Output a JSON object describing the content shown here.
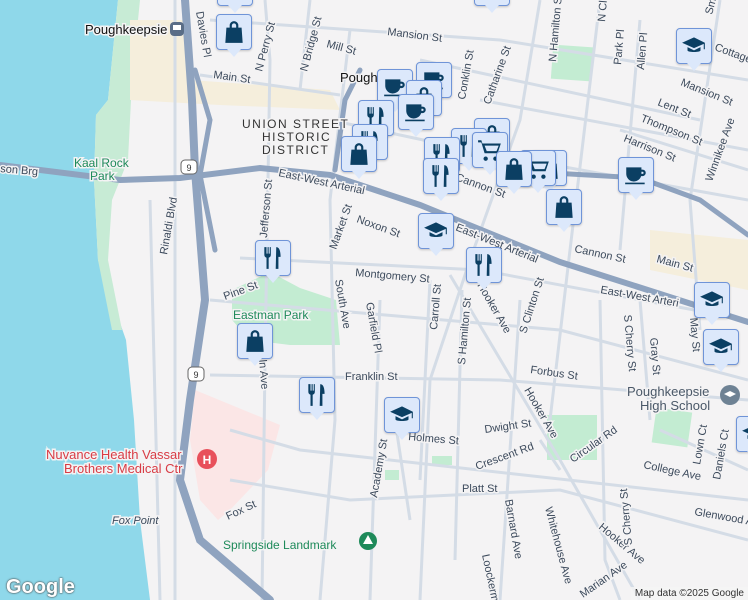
{
  "map": {
    "places": {
      "poughkeepsie_station": "Poughkeepsie",
      "pough": "Pough",
      "district": [
        "UNION STREET",
        "HISTORIC",
        "DISTRICT"
      ],
      "kaal_rock": [
        "Kaal Rock",
        "Park"
      ],
      "eastman_park": "Eastman Park",
      "hospital": [
        "Nuvance Health Vassar",
        "Brothers Medical Ctr"
      ],
      "fox_point": "Fox Point",
      "springside": "Springside Landmark",
      "high_school": [
        "Poughkeepsie",
        "High School"
      ]
    },
    "streets": {
      "davies_pl": "Davies Pl",
      "n_perry": "N Perry St",
      "n_bridge": "N Bridge St",
      "mill": "Mill St",
      "mansion": "Mansion St",
      "mansion2": "Mansion St",
      "main_w": "Main St",
      "main_e": "Main St",
      "conklin": "Conklin St",
      "catharine": "Catharine St",
      "n_hamilton": "N Hamilton St",
      "n_cl": "N Cl",
      "park_pl": "Park Pl",
      "allen_pl": "Allen Pl",
      "cottage": "Cottage St",
      "smith": "Smit",
      "lent": "Lent St",
      "thompson": "Thompson St",
      "harrison": "Harrison St",
      "winnikee": "Winnikee Ave",
      "hudson_brg": "son Brg",
      "arterial_w": "East-West Arterial",
      "arterial_m": "East-West Arterial",
      "arterial_e": "East-West Arteri",
      "rinaldi": "Rinaldi Blvd",
      "jefferson": "Jefferson St",
      "market": "Market St",
      "noxon": "Noxon St",
      "cannon": "Cannon St",
      "cannon2": "Cannon St",
      "montgomery": "Montgomery St",
      "pine": "Pine St",
      "south_ave": "South Ave",
      "garfield": "Garfield Pl",
      "carroll": "Carroll St",
      "s_hamilton": "S Hamilton St",
      "hooker": "Hooker Ave",
      "hooker2": "Hooker Ave",
      "hooker3": "Hooker Ave",
      "s_clinton": "S Clinton St",
      "s_cherry": "S Cherry St",
      "s_cherry2": "S Cherry St",
      "gray": "Gray St",
      "may": "May St",
      "forbus": "Forbus St",
      "franklin": "Franklin St",
      "lin_ave": "ln Ave",
      "dwight": "Dwight St",
      "holmes": "Holmes St",
      "crescent": "Crescent Rd",
      "circular": "Circular Rd",
      "college": "College Ave",
      "lown": "Lown Ct",
      "daniels": "Daniels Ct",
      "academy": "Academy St",
      "platt": "Platt St",
      "barnard": "Barnard Ave",
      "whitehouse": "Whitehouse Ave",
      "glenwood": "Glenwood Ave",
      "marian": "Marian Ave",
      "loockerman": "Loockerm",
      "fox_st": "Fox St"
    },
    "route_shield": "9",
    "logo": "Google",
    "attribution": "Map data ©2025 Google",
    "colors": {
      "water": "#8fd8ea",
      "highway": "#8fa3bf",
      "road": "#d4dce6",
      "park": "#c3ecd2",
      "hospital_area": "#fbe6e6",
      "marker_bg": "#dce8fb",
      "marker_icon": "#0b3f63"
    }
  }
}
